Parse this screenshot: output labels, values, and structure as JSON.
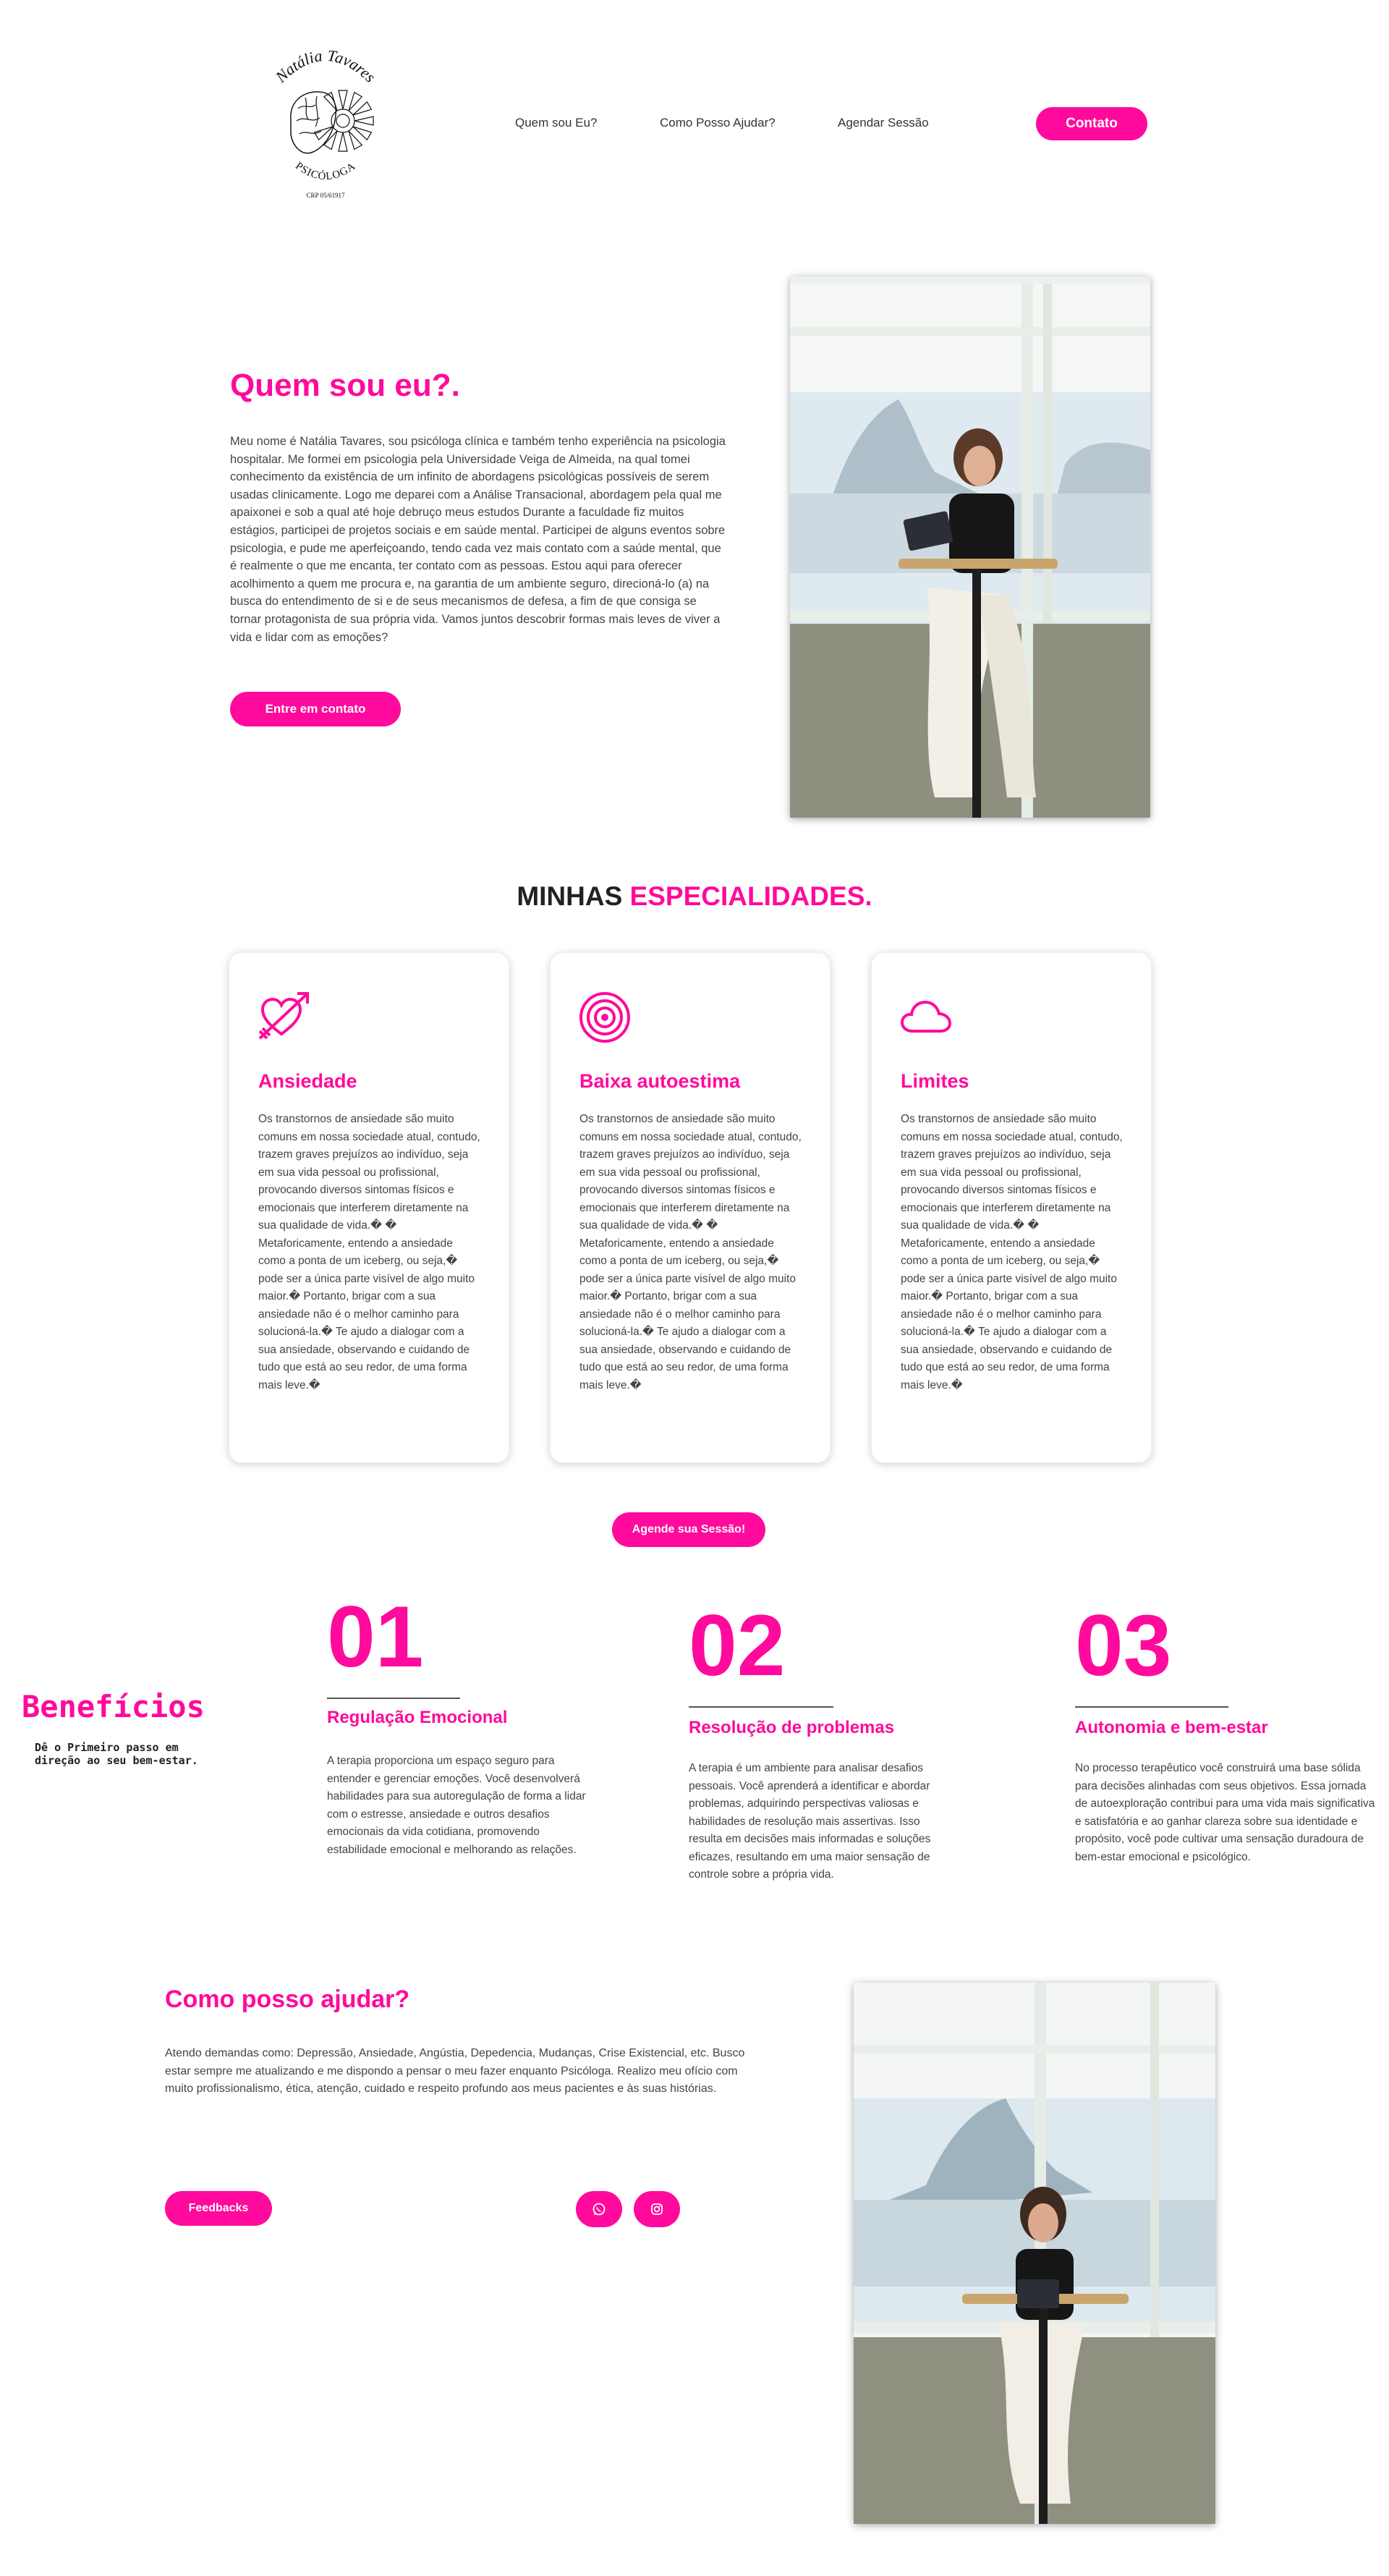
{
  "brand": {
    "name": "Natália Tavares",
    "profession": "PSICÓLOGA",
    "crp": "CRP 05/61917",
    "accent": "#ff0a9c"
  },
  "nav": {
    "items": [
      "Quem sou Eu?",
      "Como Posso Ajudar?",
      "Agendar Sessão"
    ],
    "cta": "Contato"
  },
  "about": {
    "title": "Quem sou eu?.",
    "text": "Meu nome é Natália Tavares, sou psicóloga clínica e também tenho experiência na psicologia hospitalar. Me formei em psicologia pela Universidade Veiga de Almeida, na qual tomei conhecimento da existência de um infinito de abordagens psicológicas possíveis de serem usadas clinicamente. Logo me deparei com a Análise Transacional, abordagem pela qual me apaixonei e sob a qual até hoje debruço meus estudos Durante a faculdade fiz muitos estágios, participei de projetos sociais e em saúde mental. Participei de alguns eventos sobre psicologia, e pude me aperfeiçoando, tendo cada vez mais contato com a saúde mental, que é realmente o que me encanta, ter contato com as pessoas. Estou aqui para oferecer acolhimento a quem me procura e, na garantia de um ambiente seguro, direcioná-lo (a) na busca do entendimento de si e de seus mecanismos de defesa, a fim de que consiga se tornar protagonista de sua própria vida. Vamos juntos descobrir formas mais leves de viver a vida e lidar com as emoções?",
    "button": "Entre em contato"
  },
  "specialties": {
    "title_dark": "MINHAS ",
    "title_pink": "ESPECIALIDADES.",
    "cards": [
      {
        "icon": "heart-arrow-icon",
        "title": "Ansiedade",
        "text": "Os transtornos de ansiedade são muito comuns em nossa sociedade atual, contudo, trazem graves prejuízos ao indivíduo, seja em sua vida pessoal ou profissional, provocando diversos sintomas físicos e emocionais que interferem diretamente na sua qualidade de vida.� � Metaforicamente, entendo a ansiedade como a ponta de um iceberg, ou seja,� pode ser a única parte visível de algo muito maior.� Portanto, brigar com a sua ansiedade não é o melhor caminho para solucioná-la.� Te ajudo a dialogar com a sua ansiedade, observando e cuidando de tudo que está ao seu redor, de uma forma mais leve.�"
      },
      {
        "icon": "target-icon",
        "title": "Baixa autoestima",
        "text": "Os transtornos de ansiedade são muito comuns em nossa sociedade atual, contudo, trazem graves prejuízos ao indivíduo, seja em sua vida pessoal ou profissional, provocando diversos sintomas físicos e emocionais que interferem diretamente na sua qualidade de vida.� � Metaforicamente, entendo a ansiedade como a ponta de um iceberg, ou seja,� pode ser a única parte visível de algo muito maior.� Portanto, brigar com a sua ansiedade não é o melhor caminho para solucioná-la.� Te ajudo a dialogar com a sua ansiedade, observando e cuidando de tudo que está ao seu redor, de uma forma mais leve.�"
      },
      {
        "icon": "cloud-icon",
        "title": "Limites",
        "text": "Os transtornos de ansiedade são muito comuns em nossa sociedade atual, contudo, trazem graves prejuízos ao indivíduo, seja em sua vida pessoal ou profissional, provocando diversos sintomas físicos e emocionais que interferem diretamente na sua qualidade de vida.� � Metaforicamente, entendo a ansiedade como a ponta de um iceberg, ou seja,� pode ser a única parte visível de algo muito maior.� Portanto, brigar com a sua ansiedade não é o melhor caminho para solucioná-la.� Te ajudo a dialogar com a sua ansiedade, observando e cuidando de tudo que está ao seu redor, de uma forma mais leve.�"
      }
    ],
    "button": "Agende sua Sessão!"
  },
  "benefits": {
    "title": "Benefícios",
    "subtitle": "Dê o Primeiro passo em direção ao seu bem-estar.",
    "items": [
      {
        "number": "01",
        "title": "Regulação Emocional",
        "text": "A terapia proporciona um espaço seguro para entender e gerenciar emoções. Você desenvolverá habilidades para sua autoregulação de forma a lidar com o estresse, ansiedade e outros desafios emocionais da vida cotidiana, promovendo estabilidade emocional e melhorando as relações."
      },
      {
        "number": "02",
        "title": "Resolução de problemas",
        "text": "A terapia é um ambiente para analisar desafios pessoais. Você aprenderá a identificar e abordar problemas, adquirindo perspectivas valiosas e habilidades de resolução mais assertivas. Isso resulta em decisões mais informadas e soluções eficazes, resultando em uma maior sensação de controle sobre a própria vida."
      },
      {
        "number": "03",
        "title": "Autonomia e bem-estar",
        "text": "No processo terapêutico você construirá uma base sólida para decisões alinhadas com seus objetivos. Essa jornada de autoexploração contribui para uma vida mais significativa e satisfatória e ao ganhar clareza sobre sua identidade e propósito, você pode cultivar uma sensação duradoura de bem-estar emocional e psicológico."
      }
    ]
  },
  "help": {
    "title": "Como posso ajudar?",
    "text": "Atendo demandas como: Depressão, Ansiedade, Angústia, Depedencia, Mudanças, Crise Existencial, etc. Busco estar sempre me atualizando e me dispondo a pensar o meu fazer enquanto Psicóloga. Realizo meu ofício com muito profissionalismo, ética, atenção, cuidado e respeito profundo aos meus pacientes e às suas histórias.",
    "button": "Feedbacks",
    "social": [
      "whatsapp-icon",
      "instagram-icon"
    ]
  }
}
